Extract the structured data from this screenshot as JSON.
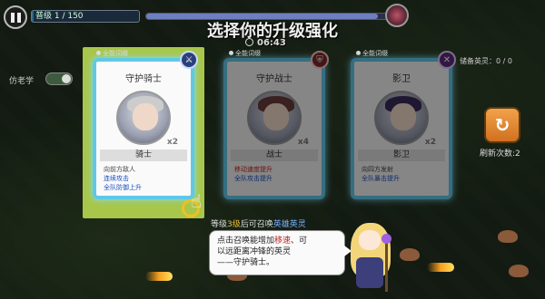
{
  "hud": {
    "wave_text": "普级 1 / 150",
    "wave_progress": 0.02,
    "boss_progress": 0.95,
    "timer": "06:43"
  },
  "title": "选择你的升级强化",
  "toggle": {
    "label": "仿老学",
    "on": true
  },
  "reserve_label": "储备英灵：0 / 0",
  "refresh": {
    "label": "刷新次数:2",
    "icon": "refresh-icon"
  },
  "cards": [
    {
      "tag": "全能词缀",
      "name": "守护骑士",
      "count": "x2",
      "role": "骑士",
      "desc": [
        "向前方敌人",
        "连续攻击",
        "全队防御上升"
      ],
      "sigil": "sword-icon"
    },
    {
      "tag": "全能词缀",
      "name": "守护战士",
      "count": "x4",
      "role": "战士",
      "desc": [
        "移动速度提升",
        "全队攻击提升"
      ],
      "sigil": "shield-icon"
    },
    {
      "tag": "全能词缀",
      "name": "影卫",
      "count": "x2",
      "role": "影卫",
      "desc": [
        "向四方发射",
        "全队暴击提升"
      ],
      "sigil": "dagger-icon"
    }
  ],
  "hint": {
    "pre": "等级",
    "lvl": "3级",
    "mid": "后可召唤",
    "tail": "英雄英灵"
  },
  "speech": {
    "l1a": "点击召唤能增加",
    "l1b": "移速",
    "l1c": "、可",
    "l2": "以远距离冲锋的英灵",
    "l3": "——守护骑士。"
  },
  "colors": {
    "accent": "#5fc8e8",
    "select_panel": "#a8c64a",
    "refresh": "#f2a24a"
  }
}
